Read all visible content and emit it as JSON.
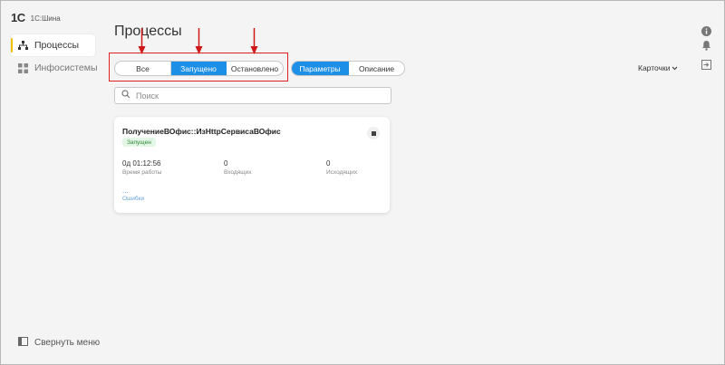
{
  "app": {
    "logo": "1С",
    "name": "1С:Шина"
  },
  "sidebar": {
    "items": [
      {
        "label": "Процессы",
        "icon": "hierarchy-icon",
        "active": true
      },
      {
        "label": "Инфосистемы",
        "icon": "grid-icon",
        "active": false
      }
    ],
    "collapse_label": "Свернуть меню"
  },
  "main": {
    "title": "Процессы",
    "status_filter": {
      "options": [
        "Все",
        "Запущено",
        "Остановлено"
      ],
      "selected": "Запущено"
    },
    "mode_tabs": {
      "options": [
        "Параметры",
        "Описание"
      ],
      "selected": "Параметры"
    },
    "view_select": {
      "label": "Карточки"
    },
    "search": {
      "placeholder": "Поиск",
      "value": ""
    },
    "cards": [
      {
        "title": "ПолучениеВОфис::ИзHttpСервисаВОфис",
        "status": "Запущен",
        "uptime_value": "0д 01:12:56",
        "uptime_label": "Время работы",
        "incoming_value": "0",
        "incoming_label": "Входящих",
        "outgoing_value": "0",
        "outgoing_label": "Исходящих",
        "errors_value": "...",
        "errors_label": "Ошибки"
      }
    ]
  },
  "colors": {
    "accent": "#1e8fe6",
    "active_marker": "#f2c200",
    "annotation": "#e02020",
    "status_bg": "#e4f6e6",
    "status_fg": "#2f8a3a"
  }
}
